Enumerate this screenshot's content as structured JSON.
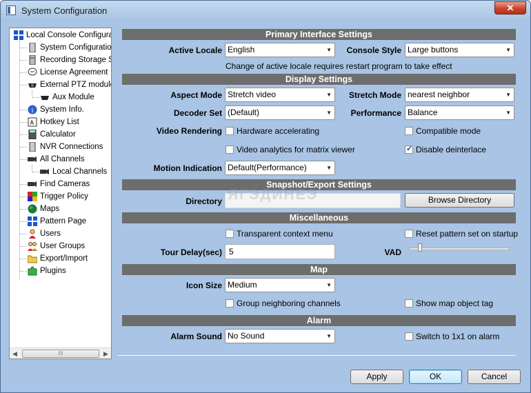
{
  "window": {
    "title": "System Configuration",
    "close_label": "✕"
  },
  "tree": {
    "root": "Local Console Configurati",
    "items": [
      {
        "label": "System Configuration"
      },
      {
        "label": "Recording Storage Se"
      },
      {
        "label": "License Agreement"
      },
      {
        "label": "External PTZ module"
      },
      {
        "label": "Aux Module"
      },
      {
        "label": "System Info."
      },
      {
        "label": "Hotkey List"
      },
      {
        "label": "Calculator"
      },
      {
        "label": "NVR Connections"
      },
      {
        "label": "All Channels"
      },
      {
        "label": "Local Channels"
      },
      {
        "label": "Find Cameras"
      },
      {
        "label": "Trigger Policy"
      },
      {
        "label": "Maps"
      },
      {
        "label": "Pattern Page"
      },
      {
        "label": "Users"
      },
      {
        "label": "User Groups"
      },
      {
        "label": "Export/Import"
      },
      {
        "label": "Plugins"
      }
    ],
    "scroll_thumb": "III"
  },
  "primary": {
    "header": "Primary Interface Settings",
    "active_locale_label": "Active Locale",
    "active_locale_value": "English",
    "console_style_label": "Console Style",
    "console_style_value": "Large buttons",
    "note": "Change of active locale requires restart program to take effect"
  },
  "display": {
    "header": "Display Settings",
    "aspect_mode_label": "Aspect Mode",
    "aspect_mode_value": "Stretch video",
    "stretch_mode_label": "Stretch Mode",
    "stretch_mode_value": "nearest neighbor",
    "decoder_set_label": "Decoder Set",
    "decoder_set_value": "(Default)",
    "performance_label": "Performance",
    "performance_value": "Balance",
    "video_rendering_label": "Video Rendering",
    "hw_accel_label": "Hardware accelerating",
    "hw_accel_checked": false,
    "compatible_label": "Compatible mode",
    "compatible_checked": false,
    "analytics_label": "Video analytics for matrix viewer",
    "analytics_checked": false,
    "deinterlace_label": "Disable deinterlace",
    "deinterlace_checked": true,
    "motion_label": "Motion Indication",
    "motion_value": "Default(Performance)"
  },
  "snapshot": {
    "header": "Snapshot/Export Settings",
    "directory_label": "Directory",
    "directory_value": "",
    "browse_label": "Browse Directory",
    "watermark": "ЯГЭДИНЕЭ"
  },
  "misc": {
    "header": "Miscellaneous",
    "transparent_label": "Transparent context menu",
    "transparent_checked": false,
    "reset_pattern_label": "Reset pattern set on startup",
    "reset_pattern_checked": false,
    "tour_delay_label": "Tour Delay(sec)",
    "tour_delay_value": "5",
    "vad_label": "VAD",
    "vad_level": 0.09
  },
  "map": {
    "header": "Map",
    "icon_size_label": "Icon Size",
    "icon_size_value": "Medium",
    "group_label": "Group neighboring channels",
    "group_checked": false,
    "show_tag_label": "Show map object tag",
    "show_tag_checked": false
  },
  "alarm": {
    "header": "Alarm",
    "sound_label": "Alarm Sound",
    "sound_value": "No Sound",
    "switch_label": "Switch to 1x1 on alarm",
    "switch_checked": false
  },
  "footer": {
    "apply": "Apply",
    "ok": "OK",
    "cancel": "Cancel"
  }
}
